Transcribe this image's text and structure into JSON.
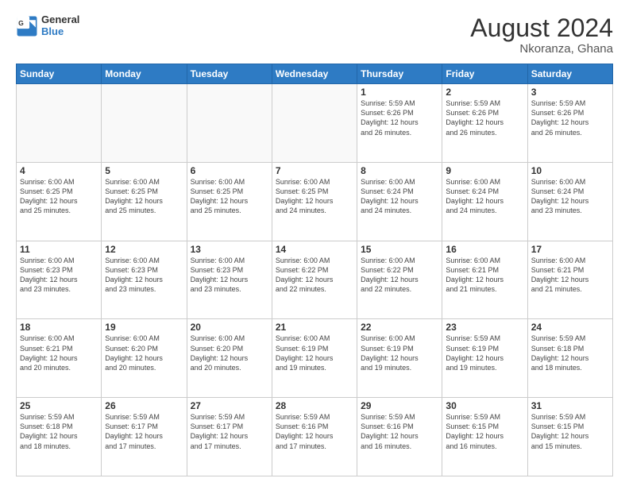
{
  "logo": {
    "line1": "General",
    "line2": "Blue"
  },
  "title": "August 2024",
  "subtitle": "Nkoranza, Ghana",
  "days_of_week": [
    "Sunday",
    "Monday",
    "Tuesday",
    "Wednesday",
    "Thursday",
    "Friday",
    "Saturday"
  ],
  "weeks": [
    [
      {
        "day": "",
        "info": ""
      },
      {
        "day": "",
        "info": ""
      },
      {
        "day": "",
        "info": ""
      },
      {
        "day": "",
        "info": ""
      },
      {
        "day": "1",
        "info": "Sunrise: 5:59 AM\nSunset: 6:26 PM\nDaylight: 12 hours\nand 26 minutes."
      },
      {
        "day": "2",
        "info": "Sunrise: 5:59 AM\nSunset: 6:26 PM\nDaylight: 12 hours\nand 26 minutes."
      },
      {
        "day": "3",
        "info": "Sunrise: 5:59 AM\nSunset: 6:26 PM\nDaylight: 12 hours\nand 26 minutes."
      }
    ],
    [
      {
        "day": "4",
        "info": "Sunrise: 6:00 AM\nSunset: 6:25 PM\nDaylight: 12 hours\nand 25 minutes."
      },
      {
        "day": "5",
        "info": "Sunrise: 6:00 AM\nSunset: 6:25 PM\nDaylight: 12 hours\nand 25 minutes."
      },
      {
        "day": "6",
        "info": "Sunrise: 6:00 AM\nSunset: 6:25 PM\nDaylight: 12 hours\nand 25 minutes."
      },
      {
        "day": "7",
        "info": "Sunrise: 6:00 AM\nSunset: 6:25 PM\nDaylight: 12 hours\nand 24 minutes."
      },
      {
        "day": "8",
        "info": "Sunrise: 6:00 AM\nSunset: 6:24 PM\nDaylight: 12 hours\nand 24 minutes."
      },
      {
        "day": "9",
        "info": "Sunrise: 6:00 AM\nSunset: 6:24 PM\nDaylight: 12 hours\nand 24 minutes."
      },
      {
        "day": "10",
        "info": "Sunrise: 6:00 AM\nSunset: 6:24 PM\nDaylight: 12 hours\nand 23 minutes."
      }
    ],
    [
      {
        "day": "11",
        "info": "Sunrise: 6:00 AM\nSunset: 6:23 PM\nDaylight: 12 hours\nand 23 minutes."
      },
      {
        "day": "12",
        "info": "Sunrise: 6:00 AM\nSunset: 6:23 PM\nDaylight: 12 hours\nand 23 minutes."
      },
      {
        "day": "13",
        "info": "Sunrise: 6:00 AM\nSunset: 6:23 PM\nDaylight: 12 hours\nand 23 minutes."
      },
      {
        "day": "14",
        "info": "Sunrise: 6:00 AM\nSunset: 6:22 PM\nDaylight: 12 hours\nand 22 minutes."
      },
      {
        "day": "15",
        "info": "Sunrise: 6:00 AM\nSunset: 6:22 PM\nDaylight: 12 hours\nand 22 minutes."
      },
      {
        "day": "16",
        "info": "Sunrise: 6:00 AM\nSunset: 6:21 PM\nDaylight: 12 hours\nand 21 minutes."
      },
      {
        "day": "17",
        "info": "Sunrise: 6:00 AM\nSunset: 6:21 PM\nDaylight: 12 hours\nand 21 minutes."
      }
    ],
    [
      {
        "day": "18",
        "info": "Sunrise: 6:00 AM\nSunset: 6:21 PM\nDaylight: 12 hours\nand 20 minutes."
      },
      {
        "day": "19",
        "info": "Sunrise: 6:00 AM\nSunset: 6:20 PM\nDaylight: 12 hours\nand 20 minutes."
      },
      {
        "day": "20",
        "info": "Sunrise: 6:00 AM\nSunset: 6:20 PM\nDaylight: 12 hours\nand 20 minutes."
      },
      {
        "day": "21",
        "info": "Sunrise: 6:00 AM\nSunset: 6:19 PM\nDaylight: 12 hours\nand 19 minutes."
      },
      {
        "day": "22",
        "info": "Sunrise: 6:00 AM\nSunset: 6:19 PM\nDaylight: 12 hours\nand 19 minutes."
      },
      {
        "day": "23",
        "info": "Sunrise: 5:59 AM\nSunset: 6:19 PM\nDaylight: 12 hours\nand 19 minutes."
      },
      {
        "day": "24",
        "info": "Sunrise: 5:59 AM\nSunset: 6:18 PM\nDaylight: 12 hours\nand 18 minutes."
      }
    ],
    [
      {
        "day": "25",
        "info": "Sunrise: 5:59 AM\nSunset: 6:18 PM\nDaylight: 12 hours\nand 18 minutes."
      },
      {
        "day": "26",
        "info": "Sunrise: 5:59 AM\nSunset: 6:17 PM\nDaylight: 12 hours\nand 17 minutes."
      },
      {
        "day": "27",
        "info": "Sunrise: 5:59 AM\nSunset: 6:17 PM\nDaylight: 12 hours\nand 17 minutes."
      },
      {
        "day": "28",
        "info": "Sunrise: 5:59 AM\nSunset: 6:16 PM\nDaylight: 12 hours\nand 17 minutes."
      },
      {
        "day": "29",
        "info": "Sunrise: 5:59 AM\nSunset: 6:16 PM\nDaylight: 12 hours\nand 16 minutes."
      },
      {
        "day": "30",
        "info": "Sunrise: 5:59 AM\nSunset: 6:15 PM\nDaylight: 12 hours\nand 16 minutes."
      },
      {
        "day": "31",
        "info": "Sunrise: 5:59 AM\nSunset: 6:15 PM\nDaylight: 12 hours\nand 15 minutes."
      }
    ]
  ]
}
